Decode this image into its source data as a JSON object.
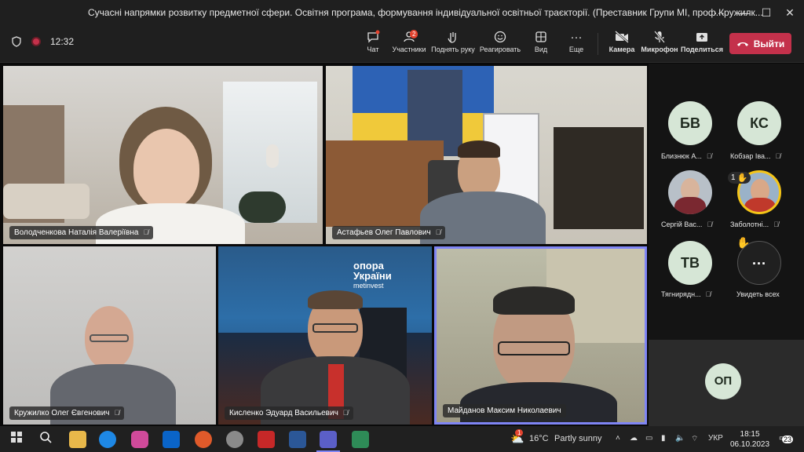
{
  "window": {
    "title": "Сучасні напрямки розвитку предметної сфери. Освітня програма, формування індивідуальної освітньої траєкторії. (Преставник Групи МІ, проф.Кружилк...",
    "more_label": "···",
    "minimize_label": "—",
    "maximize_label": "☐",
    "close_label": "✕"
  },
  "toolbar": {
    "time": "12:32",
    "participants_badge": "2",
    "items": [
      {
        "label": "Чат",
        "icon": "chat-icon"
      },
      {
        "label": "Участники",
        "icon": "people-icon"
      },
      {
        "label": "Поднять руку",
        "icon": "raise-hand-icon"
      },
      {
        "label": "Реагировать",
        "icon": "smile-icon"
      },
      {
        "label": "Вид",
        "icon": "view-icon"
      },
      {
        "label": "Еще",
        "icon": "more-icon"
      },
      {
        "label": "Камера",
        "icon": "camera-off-icon"
      },
      {
        "label": "Микрофон",
        "icon": "mic-off-icon"
      },
      {
        "label": "Поделиться",
        "icon": "share-icon"
      }
    ],
    "leave_label": "Выйти"
  },
  "tiles": [
    {
      "name": "Володченкова Наталія Валеріївна"
    },
    {
      "name": "Астафьев Олег Павлович"
    },
    {
      "name": "Кружилко Олег Євгенович"
    },
    {
      "name": "Кисленко Эдуард Васильевич"
    },
    {
      "name": "Майданов Максим Николаевич"
    }
  ],
  "tile_text": {
    "poster_line1": "опора",
    "poster_line2": "України",
    "poster_line3": "metinvest"
  },
  "side_participants": [
    {
      "initials": "БВ",
      "name": "Близнюк А..."
    },
    {
      "initials": "КС",
      "name": "Кобзар Іва..."
    },
    {
      "initials": "",
      "name": "Сергій Вас..."
    },
    {
      "initials": "",
      "name": "Заболотні...",
      "hand_count": "1"
    },
    {
      "initials": "ТВ",
      "name": "Тягнирядн..."
    },
    {
      "initials": "···",
      "name": "Увидеть всех"
    }
  ],
  "bottom_avatar": {
    "initials": "ОП"
  },
  "taskbar": {
    "weather": "16°C",
    "weather_desc": "Partly sunny",
    "lang": "УКР",
    "clock_time": "18:15",
    "clock_date": "06.10.2023",
    "notif_count": "23",
    "weather_badge": "1"
  },
  "colors": {
    "accent_leave": "#c4314b",
    "active_speaker_border": "#7f85f5",
    "avatar_bg": "#d6e6d6",
    "raised_hand_ring": "#f5c518"
  }
}
